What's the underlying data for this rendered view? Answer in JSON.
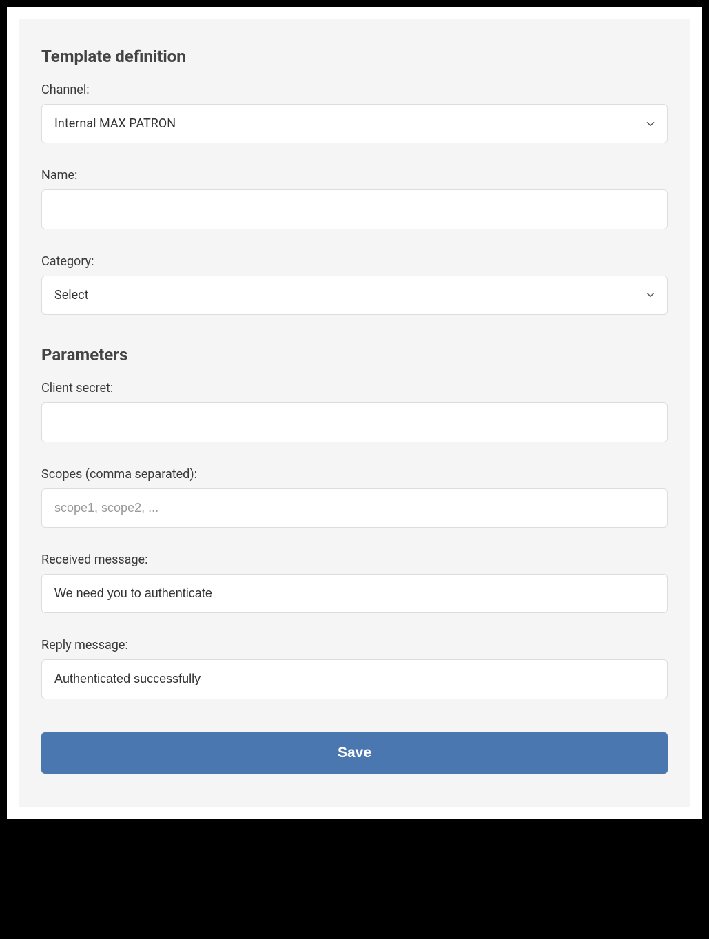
{
  "sections": {
    "template_definition": {
      "title": "Template definition",
      "channel": {
        "label": "Channel:",
        "selected": "Internal MAX PATRON"
      },
      "name": {
        "label": "Name:",
        "value": ""
      },
      "category": {
        "label": "Category:",
        "selected": "Select"
      }
    },
    "parameters": {
      "title": "Parameters",
      "client_secret": {
        "label": "Client secret:",
        "value": ""
      },
      "scopes": {
        "label": "Scopes (comma separated):",
        "value": "",
        "placeholder": "scope1, scope2, ..."
      },
      "received_message": {
        "label": "Received message:",
        "value": "We need you to authenticate"
      },
      "reply_message": {
        "label": "Reply message:",
        "value": "Authenticated successfully"
      }
    }
  },
  "actions": {
    "save_label": "Save"
  }
}
